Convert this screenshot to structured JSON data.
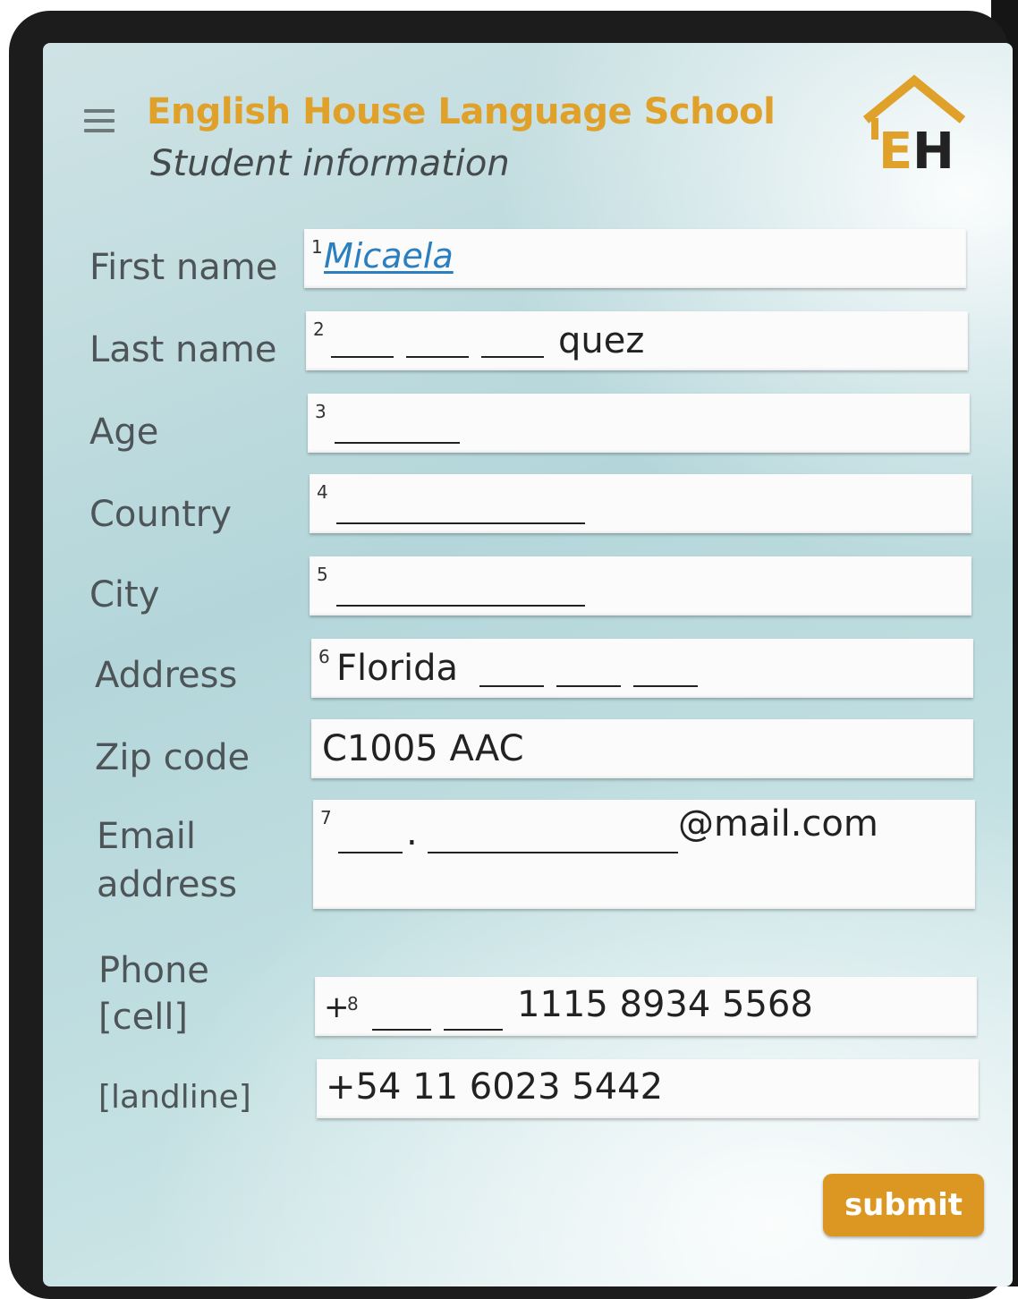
{
  "header": {
    "app_title": "English House Language School",
    "page_subtitle": "Student information",
    "logo_letters": "EH"
  },
  "form": {
    "first_name": {
      "label": "First name",
      "number": "1",
      "value": "Micaela"
    },
    "last_name": {
      "label": "Last name",
      "number": "2",
      "value_suffix": "quez"
    },
    "age": {
      "label": "Age",
      "number": "3"
    },
    "country": {
      "label": "Country",
      "number": "4"
    },
    "city": {
      "label": "City",
      "number": "5"
    },
    "address": {
      "label": "Address",
      "number": "6",
      "value_prefix": "Florida"
    },
    "zip_code": {
      "label": "Zip code",
      "value": "C1005 AAC"
    },
    "email": {
      "label_line1": "Email",
      "label_line2": "address",
      "number": "7",
      "dot": ".",
      "domain": "@mail.com"
    },
    "phone": {
      "label": "Phone",
      "cell_label": "[cell]",
      "cell_prefix": "+",
      "cell_number": "8",
      "cell_value": "1115 8934 5568",
      "landline_label": "[landline]",
      "landline_value": "+54 11 6023 5442"
    }
  },
  "actions": {
    "submit_label": "submit"
  },
  "colors": {
    "accent": "#e0a12a",
    "submit_bg": "#dc9622",
    "handwriting": "#2a7fc0",
    "device_frame": "#1c1c1c"
  },
  "icons": {
    "menu": "hamburger-menu-icon",
    "logo": "house-logo-icon"
  }
}
